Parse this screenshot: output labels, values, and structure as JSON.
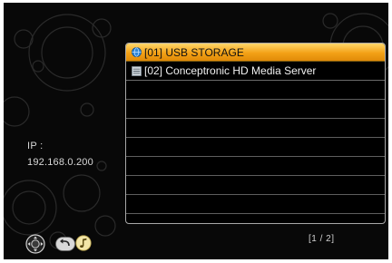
{
  "device_info": {
    "ip_label": "IP :",
    "ip_value": "192.168.0.200"
  },
  "source_list": {
    "items": [
      {
        "label": "[01] USB STORAGE",
        "icon": "usb-globe-icon",
        "selected": true
      },
      {
        "label": "[02] Conceptronic HD Media Server",
        "icon": "media-server-icon",
        "selected": false
      }
    ],
    "page_indicator": "[1 / 2]"
  },
  "controls": {
    "icons": [
      "navigation-dpad-icon",
      "return-icon",
      "music-note-icon"
    ]
  },
  "colors": {
    "background": "#080808",
    "selection": "#f3a116",
    "text": "#f0f0f0"
  }
}
